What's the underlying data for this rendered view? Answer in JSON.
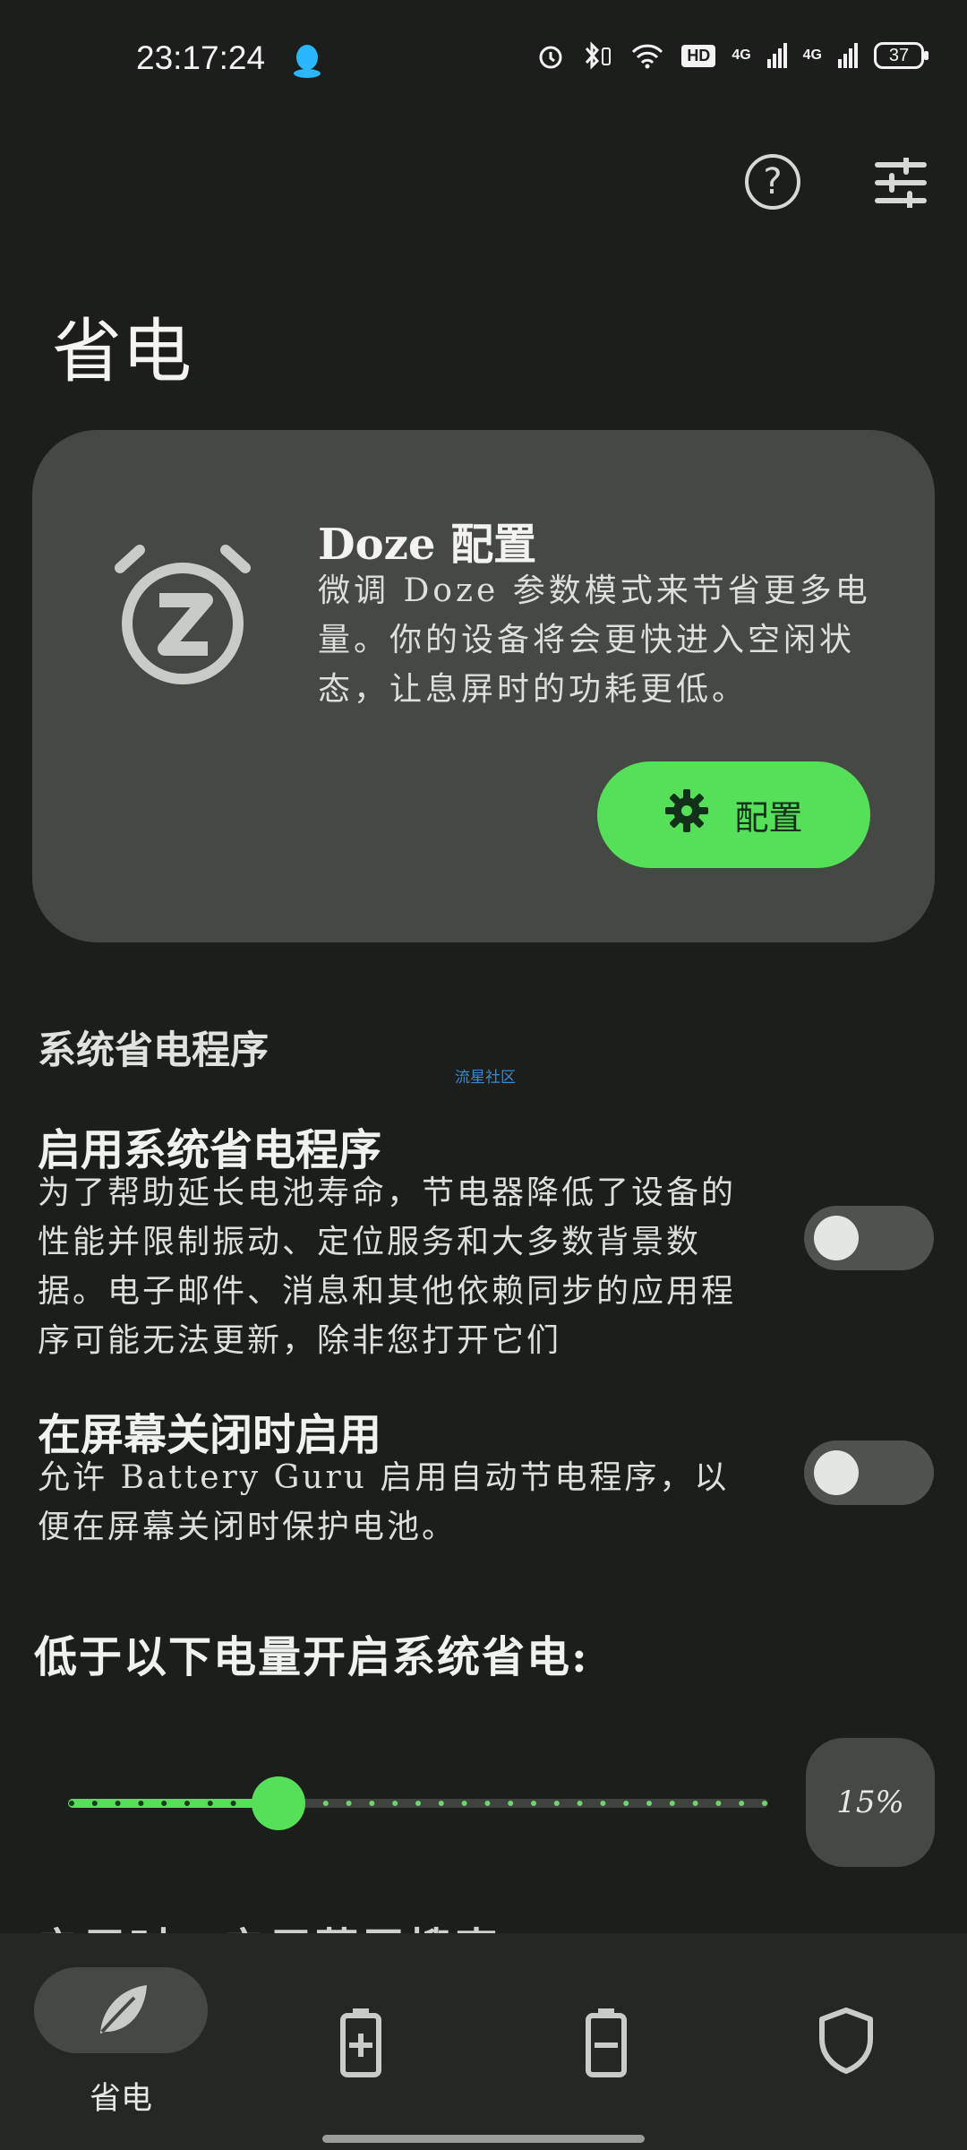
{
  "status_bar": {
    "time": "23:17:24",
    "network": "HD",
    "signal_1": "4G",
    "signal_2": "4G",
    "battery_level": "37"
  },
  "header": {
    "title": "省电",
    "help_icon": "help-circle-icon",
    "settings_icon": "tune-icon"
  },
  "doze_card": {
    "title": "Doze 配置",
    "description": "微调 Doze 参数模式来节省更多电量。你的设备将会更快进入空闲状态，让息屏时的功耗更低。",
    "button_label": "配置"
  },
  "system_saver": {
    "section_title": "系统省电程序",
    "watermark": "流星社区",
    "items": [
      {
        "title": "启用系统省电程序",
        "description": "为了帮助延长电池寿命，节电器降低了设备的性能并限制振动、定位服务和大多数背景数据。电子邮件、消息和其他依赖同步的应用程序可能无法更新，除非您打开它们",
        "enabled": false
      },
      {
        "title": "在屏幕关闭时启用",
        "description": "允许 Battery Guru 启用自动节电程序，以便在屏幕关闭时保护电池。",
        "enabled": false
      }
    ],
    "threshold_label": "低于以下电量开启系统省电:",
    "threshold_value": "15%",
    "threshold_fraction": 0.3,
    "next_item_peek": "启用时，启用蓝牙搜索..."
  },
  "bottom_nav": {
    "active_label": "省电",
    "items": [
      "leaf-icon",
      "battery-plus-icon",
      "battery-minus-icon",
      "shield-icon"
    ]
  },
  "colors": {
    "accent": "#56e05a",
    "background": "#1b1e1b",
    "card": "#454944"
  }
}
